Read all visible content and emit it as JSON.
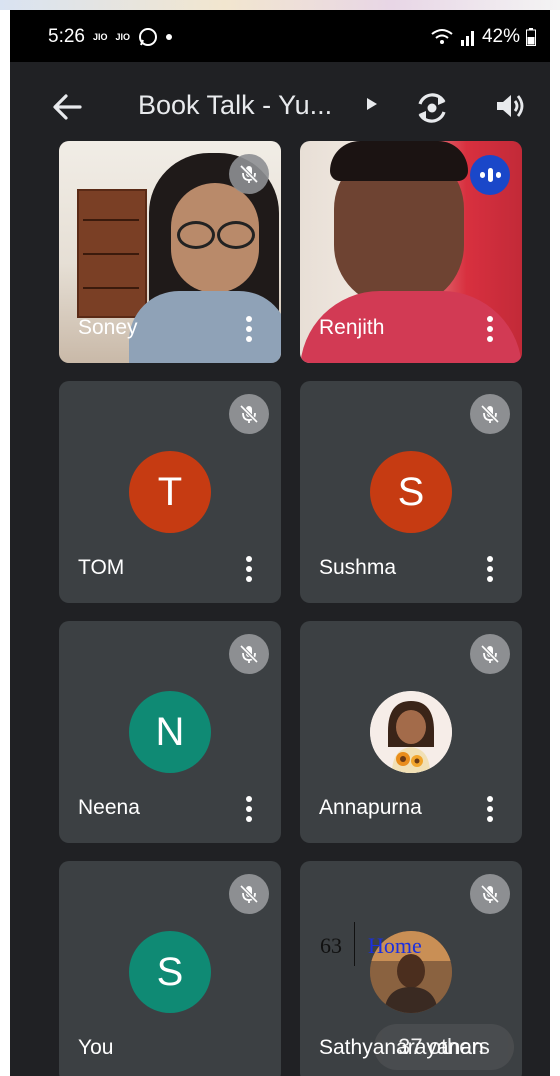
{
  "status": {
    "time": "5:26",
    "carrier1": "JIO",
    "carrier2": "JIO",
    "battery": "42%"
  },
  "call": {
    "title": "Book Talk - Yu..."
  },
  "tiles": [
    {
      "name": "Soney",
      "initial": "",
      "avatar_color": "",
      "muted": true
    },
    {
      "name": "Renjith",
      "initial": "",
      "avatar_color": "",
      "muted": false,
      "speaking": true
    },
    {
      "name": "TOM",
      "initial": "T",
      "avatar_color": "#c63b12",
      "muted": true
    },
    {
      "name": "Sushma",
      "initial": "S",
      "avatar_color": "#c63b12",
      "muted": true
    },
    {
      "name": "Neena",
      "initial": "N",
      "avatar_color": "#0f8a74",
      "muted": true
    },
    {
      "name": "Annapurna",
      "initial": "",
      "avatar_color": "",
      "muted": true
    },
    {
      "name": "You",
      "initial": "S",
      "avatar_color": "#0f8a74",
      "muted": true
    },
    {
      "name": "Sathyanarayanan",
      "initial": "",
      "avatar_color": "",
      "muted": true
    }
  ],
  "others": {
    "label": "37 others"
  },
  "overlay": {
    "page_number": "63",
    "link": "Home"
  }
}
